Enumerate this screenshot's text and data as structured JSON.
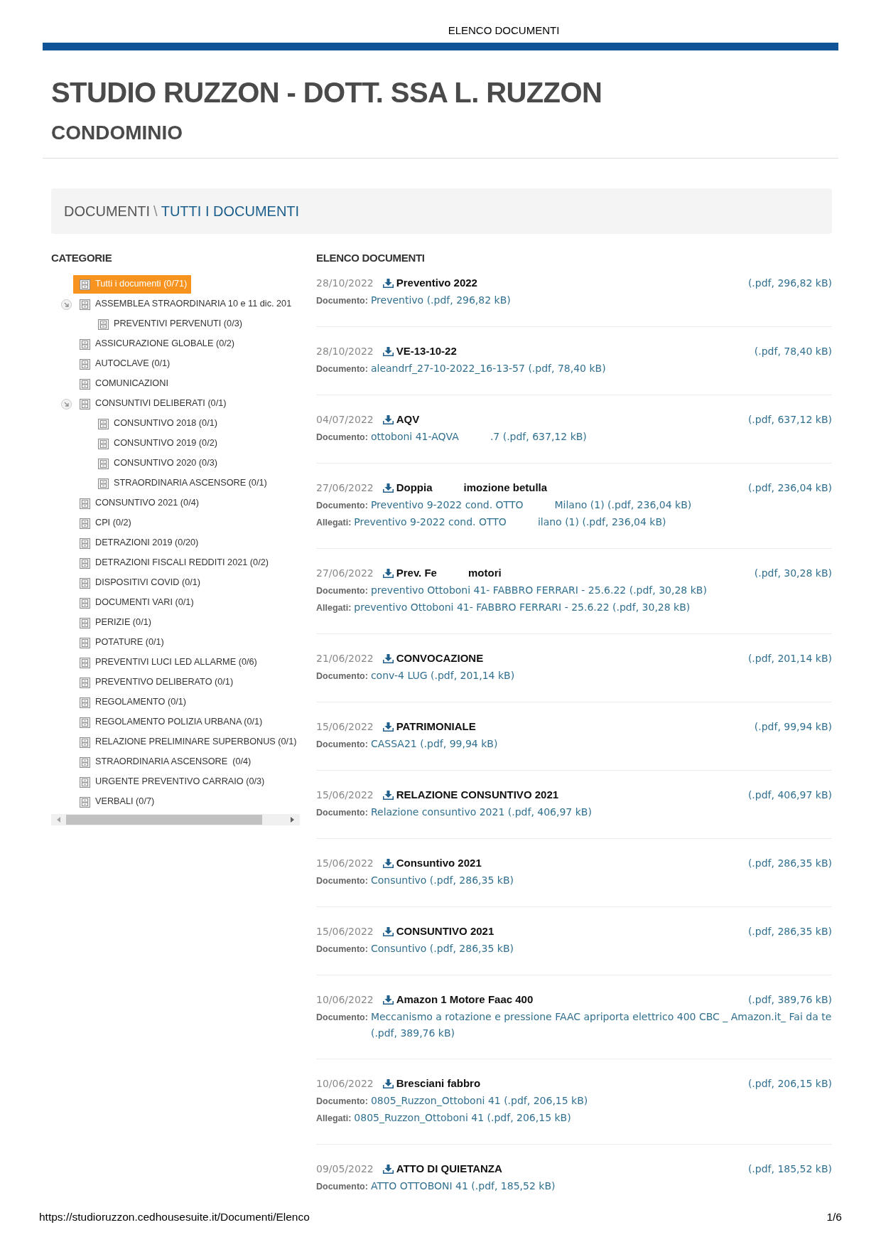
{
  "print_header": {
    "title": "ELENCO DOCUMENTI"
  },
  "site": {
    "title": "STUDIO RUZZON - DOTT. SSA L. RUZZON",
    "subtitle": "CONDOMINIO"
  },
  "breadcrumb": {
    "separator": "\\",
    "items": [
      {
        "label": "DOCUMENTI",
        "current": false
      },
      {
        "label": "TUTTI I DOCUMENTI",
        "current": true
      }
    ]
  },
  "sidebar": {
    "title": "CATEGORIE",
    "items": [
      {
        "label": "Tutti i documenti (0/71)",
        "selected": true
      },
      {
        "label": "ASSEMBLEA STRAORDINARIA 10 e 11 dic. 201",
        "selected": false,
        "expanded": true,
        "children": [
          {
            "label": "PREVENTIVI PERVENUTI (0/3)",
            "selected": false
          }
        ]
      },
      {
        "label": "ASSICURAZIONE GLOBALE (0/2)",
        "selected": false
      },
      {
        "label": "AUTOCLAVE (0/1)",
        "selected": false
      },
      {
        "label": "COMUNICAZIONI",
        "selected": false
      },
      {
        "label": "CONSUNTIVI DELIBERATI (0/1)",
        "selected": false,
        "expanded": true,
        "children": [
          {
            "label": "CONSUNTIVO 2018 (0/1)",
            "selected": false
          },
          {
            "label": "CONSUNTIVO 2019 (0/2)",
            "selected": false
          },
          {
            "label": "CONSUNTIVO 2020 (0/3)",
            "selected": false
          },
          {
            "label": "STRAORDINARIA ASCENSORE (0/1)",
            "selected": false
          }
        ]
      },
      {
        "label": "CONSUNTIVO 2021 (0/4)",
        "selected": false
      },
      {
        "label": "CPI (0/2)",
        "selected": false
      },
      {
        "label": "DETRAZIONI 2019 (0/20)",
        "selected": false
      },
      {
        "label": "DETRAZIONI FISCALI REDDITI 2021 (0/2)",
        "selected": false
      },
      {
        "label": "DISPOSITIVI COVID (0/1)",
        "selected": false
      },
      {
        "label": "DOCUMENTI VARI (0/1)",
        "selected": false
      },
      {
        "label": "PERIZIE (0/1)",
        "selected": false
      },
      {
        "label": "POTATURE (0/1)",
        "selected": false
      },
      {
        "label": "PREVENTIVI LUCI LED ALLARME (0/6)",
        "selected": false
      },
      {
        "label": "PREVENTIVO DELIBERATO (0/1)",
        "selected": false
      },
      {
        "label": "REGOLAMENTO (0/1)",
        "selected": false
      },
      {
        "label": "REGOLAMENTO POLIZIA URBANA (0/1)",
        "selected": false
      },
      {
        "label": "RELAZIONE PRELIMINARE SUPERBONUS (0/1)",
        "selected": false
      },
      {
        "label": "STRAORDINARIA ASCENSORE  (0/4)",
        "selected": false
      },
      {
        "label": "URGENTE PREVENTIVO CARRAIO (0/3)",
        "selected": false
      },
      {
        "label": "VERBALI (0/7)",
        "selected": false
      }
    ]
  },
  "documents": {
    "title": "ELENCO DOCUMENTI",
    "items": [
      {
        "date": "28/10/2022",
        "title": [
          "Preventivo 2022"
        ],
        "size": "(.pdf, 296,82 kB)",
        "files": [
          {
            "label": "Documento:",
            "text": [
              "Preventivo (.pdf, 296,82 kB)"
            ]
          }
        ]
      },
      {
        "date": "28/10/2022",
        "title": [
          "VE-13-10-22"
        ],
        "size": "(.pdf, 78,40 kB)",
        "files": [
          {
            "label": "Documento:",
            "text": [
              "aleandrf_27-10-2022_16-13-57 (.pdf, 78,40 kB)"
            ]
          }
        ]
      },
      {
        "date": "04/07/2022",
        "title": [
          "AQV"
        ],
        "size": "(.pdf, 637,12 kB)",
        "files": [
          {
            "label": "Documento:",
            "text": [
              "ottoboni 41-AQVA",
              ".7 (.pdf, 637,12 kB)"
            ]
          }
        ]
      },
      {
        "date": "27/06/2022",
        "title": [
          "Doppia",
          "imozione betulla"
        ],
        "size": "(.pdf, 236,04 kB)",
        "files": [
          {
            "label": "Documento:",
            "text": [
              "Preventivo 9-2022 cond. OTTO",
              "Milano (1) (.pdf, 236,04 kB)"
            ]
          },
          {
            "label": "Allegati:",
            "text": [
              "Preventivo 9-2022 cond. OTTO",
              "ilano (1) (.pdf, 236,04 kB)"
            ]
          }
        ]
      },
      {
        "date": "27/06/2022",
        "title": [
          "Prev. Fe",
          "motori"
        ],
        "size": "(.pdf, 30,28 kB)",
        "files": [
          {
            "label": "Documento:",
            "text": [
              "preventivo Ottoboni 41- FABBRO FERRARI - 25.6.22 (.pdf, 30,28 kB)"
            ]
          },
          {
            "label": "Allegati:",
            "text": [
              "preventivo Ottoboni 41- FABBRO FERRARI - 25.6.22 (.pdf, 30,28 kB)"
            ]
          }
        ]
      },
      {
        "date": "21/06/2022",
        "title": [
          "CONVOCAZIONE"
        ],
        "size": "(.pdf, 201,14 kB)",
        "files": [
          {
            "label": "Documento:",
            "text": [
              "conv-4 LUG (.pdf, 201,14 kB)"
            ]
          }
        ]
      },
      {
        "date": "15/06/2022",
        "title": [
          "PATRIMONIALE"
        ],
        "size": "(.pdf, 99,94 kB)",
        "files": [
          {
            "label": "Documento:",
            "text": [
              "CASSA21 (.pdf, 99,94 kB)"
            ]
          }
        ]
      },
      {
        "date": "15/06/2022",
        "title": [
          "RELAZIONE CONSUNTIVO 2021"
        ],
        "size": "(.pdf, 406,97 kB)",
        "files": [
          {
            "label": "Documento:",
            "text": [
              "Relazione consuntivo 2021 (.pdf, 406,97 kB)"
            ]
          }
        ]
      },
      {
        "date": "15/06/2022",
        "title": [
          "Consuntivo 2021"
        ],
        "size": "(.pdf, 286,35 kB)",
        "files": [
          {
            "label": "Documento:",
            "text": [
              "Consuntivo (.pdf, 286,35 kB)"
            ]
          }
        ]
      },
      {
        "date": "15/06/2022",
        "title": [
          "CONSUNTIVO 2021"
        ],
        "size": "(.pdf, 286,35 kB)",
        "files": [
          {
            "label": "Documento:",
            "text": [
              "Consuntivo (.pdf, 286,35 kB)"
            ]
          }
        ]
      },
      {
        "date": "10/06/2022",
        "title": [
          "Amazon 1 Motore Faac 400"
        ],
        "size": "(.pdf, 389,76 kB)",
        "files": [
          {
            "label": "Documento:",
            "text": [
              "Meccanismo a rotazione e pressione FAAC apriporta elettrico 400 CBC _ Amazon.it_ Fai da te (.pdf, 389,76 kB)"
            ]
          }
        ]
      },
      {
        "date": "10/06/2022",
        "title": [
          "Bresciani fabbro"
        ],
        "size": "(.pdf, 206,15 kB)",
        "files": [
          {
            "label": "Documento:",
            "text": [
              "0805_Ruzzon_Ottoboni 41 (.pdf, 206,15 kB)"
            ]
          },
          {
            "label": "Allegati:",
            "text": [
              "0805_Ruzzon_Ottoboni 41 (.pdf, 206,15 kB)"
            ]
          }
        ]
      },
      {
        "date": "09/05/2022",
        "title": [
          "ATTO DI QUIETANZA"
        ],
        "size": "(.pdf, 185,52 kB)",
        "files": [
          {
            "label": "Documento:",
            "text": [
              "ATTO OTTOBONI 41 (.pdf, 185,52 kB)"
            ]
          }
        ]
      }
    ]
  },
  "print_footer": {
    "url": "https://studioruzzon.cedhousesuite.it/Documenti/Elenco",
    "page": "1/6"
  }
}
